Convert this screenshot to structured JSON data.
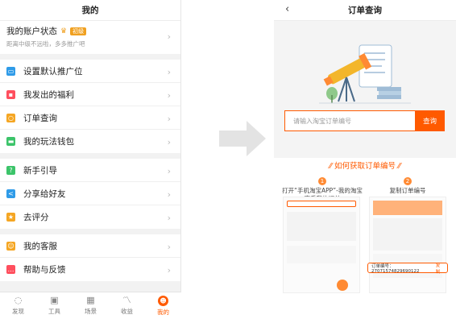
{
  "left": {
    "header_title": "我的",
    "account": {
      "title": "我的账户状态",
      "level": "初级",
      "subtitle": "距离中级不远啦，多多推广吧"
    },
    "group1": [
      {
        "label": "设置默认推广位",
        "icon": "id-card-icon",
        "color": "#2f9be8"
      },
      {
        "label": "我发出的福利",
        "icon": "gift-icon",
        "color": "#ff4f5e"
      },
      {
        "label": "订单查询",
        "icon": "search-icon",
        "color": "#f5a623"
      },
      {
        "label": "我的玩法钱包",
        "icon": "wallet-icon",
        "color": "#3cc46a"
      }
    ],
    "group2": [
      {
        "label": "新手引导",
        "icon": "question-icon",
        "color": "#3cc46a"
      },
      {
        "label": "分享给好友",
        "icon": "share-icon",
        "color": "#2f9be8"
      },
      {
        "label": "去评分",
        "icon": "medal-icon",
        "color": "#f5a623"
      }
    ],
    "group3": [
      {
        "label": "我的客服",
        "icon": "service-icon",
        "color": "#f5a623"
      },
      {
        "label": "帮助与反馈",
        "icon": "chat-icon",
        "color": "#ff4f5e"
      }
    ],
    "tabs": [
      {
        "label": "发现",
        "icon": "bulb-icon"
      },
      {
        "label": "工具",
        "icon": "toolbox-icon"
      },
      {
        "label": "场景",
        "icon": "grid-icon"
      },
      {
        "label": "收益",
        "icon": "chart-icon"
      },
      {
        "label": "我的",
        "icon": "face-icon",
        "active": true
      }
    ]
  },
  "right": {
    "header_title": "订单查询",
    "search_placeholder": "请输入淘宝订单编号",
    "search_button": "查询",
    "howto_title": "如何获取订单编号",
    "step1_num": "1",
    "step1_text": "打开“手机淘宝APP”-我的淘宝查看我的订单",
    "step2_num": "2",
    "step2_text": "复制订单编号",
    "order_label": "订单编号：27071574829690122",
    "order_copy": "复制"
  },
  "colors": {
    "accent": "#ff5a00"
  }
}
